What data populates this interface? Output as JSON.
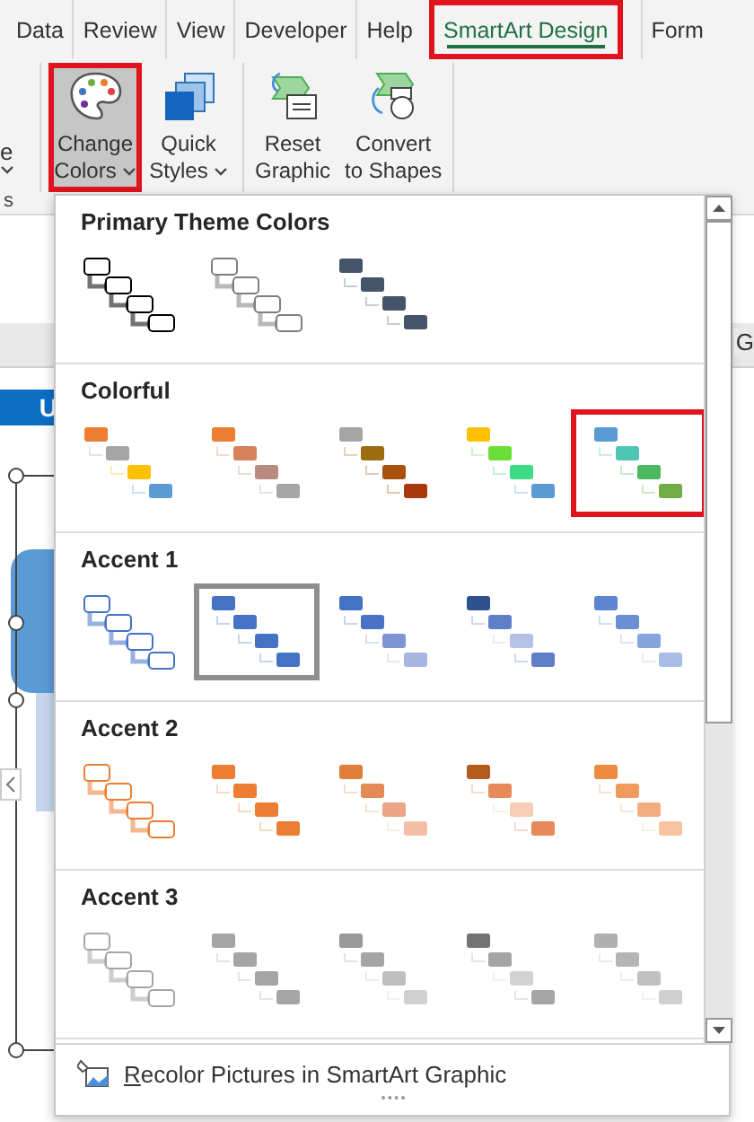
{
  "tabs": [
    {
      "label": "Data",
      "selected": false,
      "highlighted": false
    },
    {
      "label": "Review",
      "selected": false,
      "highlighted": false
    },
    {
      "label": "View",
      "selected": false,
      "highlighted": false
    },
    {
      "label": "Developer",
      "selected": false,
      "highlighted": false
    },
    {
      "label": "Help",
      "selected": false,
      "highlighted": false
    },
    {
      "label": "SmartArt Design",
      "selected": true,
      "highlighted": true
    },
    {
      "label": "Form",
      "selected": false,
      "highlighted": false
    }
  ],
  "ribbon": {
    "cut_button": {
      "label": "e"
    },
    "group_label": "s",
    "buttons": [
      {
        "kind": "palette",
        "lines": [
          "Change",
          "Colors"
        ],
        "dropdown": true,
        "pressed": true,
        "highlighted": true
      },
      {
        "kind": "styles",
        "lines": [
          "Quick",
          "Styles"
        ],
        "dropdown": true,
        "pressed": false,
        "highlighted": false
      },
      {
        "kind": "reset",
        "lines": [
          "Reset",
          "Graphic"
        ],
        "dropdown": false,
        "pressed": false,
        "highlighted": false
      },
      {
        "kind": "convert",
        "lines": [
          "Convert",
          "to Shapes"
        ],
        "dropdown": false,
        "pressed": false,
        "highlighted": false
      }
    ]
  },
  "sheet": {
    "column_header": "G",
    "shape_label": "U"
  },
  "gallery": {
    "sections": [
      {
        "title": "Primary Theme Colors",
        "items": [
          {
            "kind": "outline",
            "boxes": [
              {
                "color": "#000000"
              },
              {
                "color": "#000000"
              },
              {
                "color": "#000000"
              },
              {
                "color": "#000000"
              }
            ],
            "selected": false,
            "highlighted": false
          },
          {
            "kind": "outline",
            "boxes": [
              {
                "color": "#7f7f7f"
              },
              {
                "color": "#7f7f7f"
              },
              {
                "color": "#7f7f7f"
              },
              {
                "color": "#7f7f7f"
              }
            ],
            "selected": false,
            "highlighted": false
          },
          {
            "kind": "filled",
            "boxes": [
              {
                "color": "#44546a"
              },
              {
                "color": "#44546a"
              },
              {
                "color": "#44546a"
              },
              {
                "color": "#44546a"
              }
            ],
            "selected": false,
            "highlighted": false
          }
        ]
      },
      {
        "title": "Colorful",
        "items": [
          {
            "kind": "filled",
            "boxes": [
              {
                "color": "#ed7d31"
              },
              {
                "color": "#a5a5a5"
              },
              {
                "color": "#ffc000"
              },
              {
                "color": "#5b9bd5"
              }
            ],
            "selected": false,
            "highlighted": false
          },
          {
            "kind": "filled",
            "boxes": [
              {
                "color": "#ed7d31"
              },
              {
                "color": "#d9805c"
              },
              {
                "color": "#b98a80"
              },
              {
                "color": "#a5a5a5"
              }
            ],
            "selected": false,
            "highlighted": false
          },
          {
            "kind": "filled",
            "boxes": [
              {
                "color": "#a5a5a5"
              },
              {
                "color": "#9c6c10"
              },
              {
                "color": "#a8510d"
              },
              {
                "color": "#a9380a"
              }
            ],
            "selected": false,
            "highlighted": false
          },
          {
            "kind": "filled",
            "boxes": [
              {
                "color": "#ffc000"
              },
              {
                "color": "#6ae037"
              },
              {
                "color": "#3ddc84"
              },
              {
                "color": "#5b9bd5"
              }
            ],
            "selected": false,
            "highlighted": false
          },
          {
            "kind": "filled",
            "boxes": [
              {
                "color": "#5b9bd5"
              },
              {
                "color": "#4fc6b4"
              },
              {
                "color": "#4cb860"
              },
              {
                "color": "#70ad47"
              }
            ],
            "selected": false,
            "highlighted": true
          }
        ]
      },
      {
        "title": "Accent 1",
        "items": [
          {
            "kind": "outline",
            "boxes": [
              {
                "color": "#4472c4"
              },
              {
                "color": "#4472c4"
              },
              {
                "color": "#4472c4"
              },
              {
                "color": "#4472c4"
              }
            ],
            "selected": false,
            "highlighted": false
          },
          {
            "kind": "filled",
            "boxes": [
              {
                "color": "#4472c4"
              },
              {
                "color": "#4472c4"
              },
              {
                "color": "#4472c4"
              },
              {
                "color": "#4472c4"
              }
            ],
            "selected": true,
            "highlighted": false
          },
          {
            "kind": "filled",
            "boxes": [
              {
                "color": "#4472c4"
              },
              {
                "color": "#4a73c5"
              },
              {
                "color": "#7d96d3"
              },
              {
                "color": "#a8b7e0"
              }
            ],
            "selected": false,
            "highlighted": false
          },
          {
            "kind": "filled",
            "boxes": [
              {
                "color": "#2f528f"
              },
              {
                "color": "#5f7fc9"
              },
              {
                "color": "#b4c2e6"
              },
              {
                "color": "#5f7fc9"
              }
            ],
            "selected": false,
            "highlighted": false
          },
          {
            "kind": "filled",
            "boxes": [
              {
                "color": "#5b85d1"
              },
              {
                "color": "#6a8fd4"
              },
              {
                "color": "#86a4de"
              },
              {
                "color": "#a8bde6"
              }
            ],
            "selected": false,
            "highlighted": false
          }
        ]
      },
      {
        "title": "Accent 2",
        "items": [
          {
            "kind": "outline",
            "boxes": [
              {
                "color": "#ed7d31"
              },
              {
                "color": "#ed7d31"
              },
              {
                "color": "#ed7d31"
              },
              {
                "color": "#ed7d31"
              }
            ],
            "selected": false,
            "highlighted": false
          },
          {
            "kind": "filled",
            "boxes": [
              {
                "color": "#ed7d31"
              },
              {
                "color": "#ed7d31"
              },
              {
                "color": "#ed7d31"
              },
              {
                "color": "#ed7d31"
              }
            ],
            "selected": false,
            "highlighted": false
          },
          {
            "kind": "filled",
            "boxes": [
              {
                "color": "#e07d3a"
              },
              {
                "color": "#e48a55"
              },
              {
                "color": "#eba585"
              },
              {
                "color": "#f2bfa4"
              }
            ],
            "selected": false,
            "highlighted": false
          },
          {
            "kind": "filled",
            "boxes": [
              {
                "color": "#b35a1f"
              },
              {
                "color": "#e8895a"
              },
              {
                "color": "#f6cdb5"
              },
              {
                "color": "#e8895a"
              }
            ],
            "selected": false,
            "highlighted": false
          },
          {
            "kind": "filled",
            "boxes": [
              {
                "color": "#f08a40"
              },
              {
                "color": "#f29a5e"
              },
              {
                "color": "#f3ad80"
              },
              {
                "color": "#f6c4a1"
              }
            ],
            "selected": false,
            "highlighted": false
          }
        ]
      },
      {
        "title": "Accent 3",
        "items": [
          {
            "kind": "outline",
            "boxes": [
              {
                "color": "#a5a5a5"
              },
              {
                "color": "#a5a5a5"
              },
              {
                "color": "#a5a5a5"
              },
              {
                "color": "#a5a5a5"
              }
            ],
            "selected": false,
            "highlighted": false
          },
          {
            "kind": "filled",
            "boxes": [
              {
                "color": "#a5a5a5"
              },
              {
                "color": "#a5a5a5"
              },
              {
                "color": "#a5a5a5"
              },
              {
                "color": "#a5a5a5"
              }
            ],
            "selected": false,
            "highlighted": false
          },
          {
            "kind": "filled",
            "boxes": [
              {
                "color": "#999999"
              },
              {
                "color": "#a5a5a5"
              },
              {
                "color": "#bfbfbf"
              },
              {
                "color": "#d0d0d0"
              }
            ],
            "selected": false,
            "highlighted": false
          },
          {
            "kind": "filled",
            "boxes": [
              {
                "color": "#737373"
              },
              {
                "color": "#a5a5a5"
              },
              {
                "color": "#d3d3d3"
              },
              {
                "color": "#a5a5a5"
              }
            ],
            "selected": false,
            "highlighted": false
          },
          {
            "kind": "filled",
            "boxes": [
              {
                "color": "#b0b0b0"
              },
              {
                "color": "#b5b5b5"
              },
              {
                "color": "#c0c0c0"
              },
              {
                "color": "#cfcfcf"
              }
            ],
            "selected": false,
            "highlighted": false
          }
        ]
      }
    ],
    "footer": {
      "label": "Recolor Pictures in SmartArt Graphic"
    }
  }
}
